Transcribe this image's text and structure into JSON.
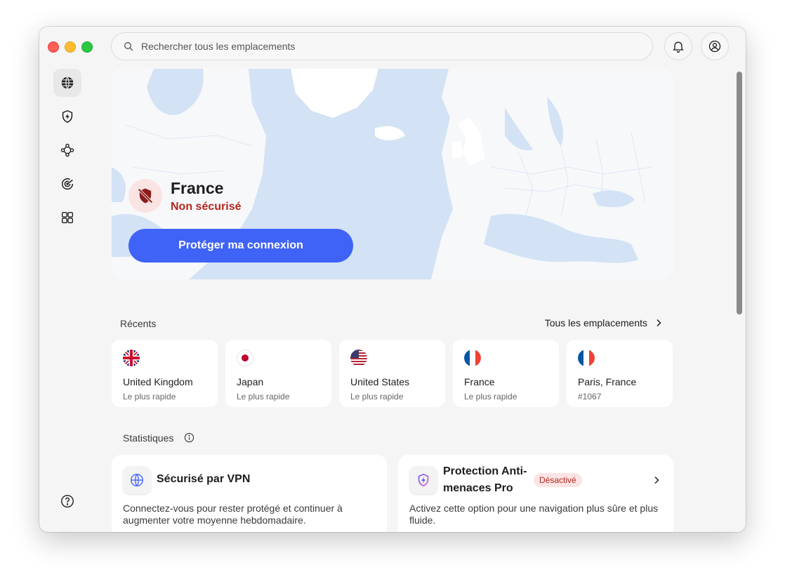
{
  "search": {
    "placeholder": "Rechercher tous les emplacements"
  },
  "hero": {
    "country": "France",
    "status": "Non sécurisé",
    "button_label": "Protéger ma connexion"
  },
  "recents": {
    "label": "Récents",
    "all_label": "Tous les emplacements",
    "items": [
      {
        "name": "United Kingdom",
        "sub": "Le plus rapide",
        "flag": "uk-flag"
      },
      {
        "name": "Japan",
        "sub": "Le plus rapide",
        "flag": "japan-flag"
      },
      {
        "name": "United States",
        "sub": "Le plus rapide",
        "flag": "us-flag"
      },
      {
        "name": "France",
        "sub": "Le plus rapide",
        "flag": "france-flag"
      },
      {
        "name": "Paris, France",
        "sub": "#1067",
        "flag": "france-flag"
      }
    ]
  },
  "stats": {
    "label": "Statistiques",
    "vpn": {
      "title": "Sécurisé par VPN",
      "desc": "Connectez-vous pour rester protégé et continuer à augmenter votre moyenne hebdomadaire."
    },
    "threat": {
      "title_line1": "Protection Anti-",
      "title_line2": "menaces Pro",
      "badge": "Désactivé",
      "desc": "Activez cette option pour une navigation plus sûre et plus fluide."
    }
  },
  "colors": {
    "accent": "#3f63f7",
    "danger": "#b3261e",
    "map_water": "#d3e2f5"
  }
}
